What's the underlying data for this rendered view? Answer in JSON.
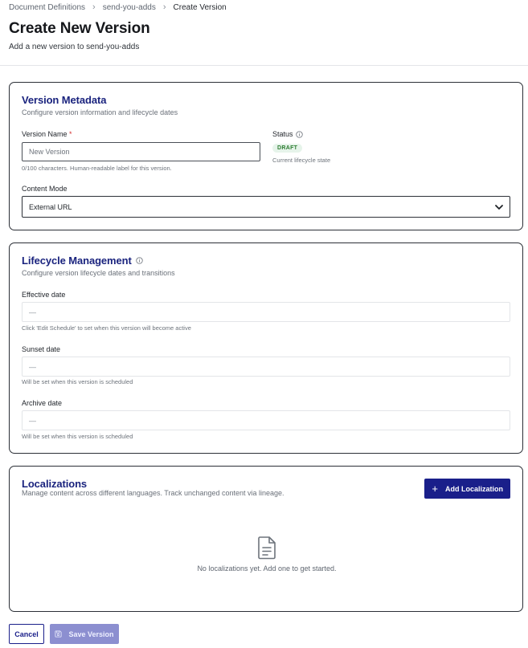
{
  "breadcrumb": {
    "items": [
      "Document Definitions",
      "send-you-adds",
      "Create Version"
    ]
  },
  "header": {
    "title": "Create New Version",
    "subtitle": "Add a new version to send-you-adds"
  },
  "metadata": {
    "title": "Version Metadata",
    "description": "Configure version information and lifecycle dates",
    "version_name_label": "Version Name",
    "required_mark": "*",
    "version_name_placeholder": "New Version",
    "version_name_help": "0/100 characters. Human-readable label for this version.",
    "status_label": "Status",
    "status_badge": "DRAFT",
    "status_help": "Current lifecycle state",
    "content_mode_label": "Content Mode",
    "content_mode_value": "External URL"
  },
  "lifecycle": {
    "title": "Lifecycle Management",
    "description": "Configure version lifecycle dates and transitions",
    "effective_label": "Effective date",
    "effective_value": "—",
    "effective_help": "Click 'Edit Schedule' to set when this version will become active",
    "sunset_label": "Sunset date",
    "sunset_value": "—",
    "sunset_help": "Will be set when this version is scheduled",
    "archive_label": "Archive date",
    "archive_value": "—",
    "archive_help": "Will be set when this version is scheduled"
  },
  "localizations": {
    "title": "Localizations",
    "description": "Manage content across different languages. Track unchanged content via lineage.",
    "add_button": "Add Localization",
    "empty_text": "No localizations yet. Add one to get started."
  },
  "footer": {
    "cancel_label": "Cancel",
    "save_label": "Save Version"
  },
  "colors": {
    "brand": "#1a1f8a",
    "title_blue": "#1a237e",
    "draft_bg": "#e6f4ea",
    "draft_text": "#2e7d32",
    "save_disabled": "#8c8fd0"
  }
}
